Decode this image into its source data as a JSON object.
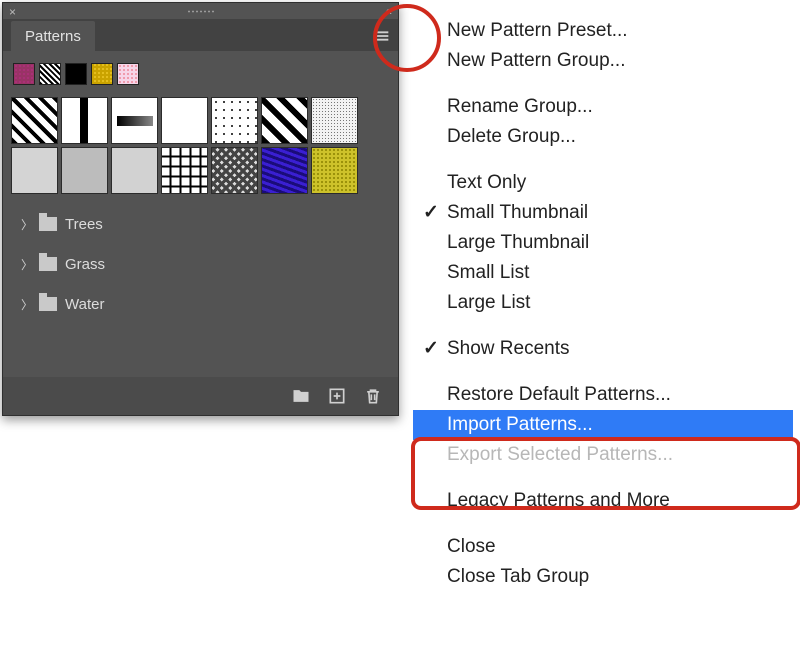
{
  "panel": {
    "title": "Patterns",
    "recents": [
      {
        "name": "pattern-noise-pink"
      },
      {
        "name": "pattern-stripe"
      },
      {
        "name": "pattern-black"
      },
      {
        "name": "pattern-yellow"
      },
      {
        "name": "pattern-pink-dots"
      }
    ],
    "grid": [
      "diagonal-stripes",
      "vertical-line",
      "horizontal-bar",
      "white",
      "dot-grid",
      "diagonal-thick",
      "fine-noise",
      "texture-1",
      "texture-2",
      "texture-3",
      "concentric-squares",
      "maze",
      "purple-wave",
      "gold-flecks"
    ],
    "folders": [
      {
        "label": "Trees"
      },
      {
        "label": "Grass"
      },
      {
        "label": "Water"
      }
    ],
    "footer": {
      "folder": "New group",
      "new": "Create new pattern",
      "trash": "Delete"
    }
  },
  "menu": {
    "items": [
      {
        "label": "New Pattern Preset...",
        "type": "item"
      },
      {
        "label": "New Pattern Group...",
        "type": "item"
      },
      {
        "type": "sep"
      },
      {
        "label": "Rename Group...",
        "type": "item"
      },
      {
        "label": "Delete Group...",
        "type": "item"
      },
      {
        "type": "sep"
      },
      {
        "label": "Text Only",
        "type": "item"
      },
      {
        "label": "Small Thumbnail",
        "type": "item",
        "checked": true
      },
      {
        "label": "Large Thumbnail",
        "type": "item"
      },
      {
        "label": "Small List",
        "type": "item"
      },
      {
        "label": "Large List",
        "type": "item"
      },
      {
        "type": "sep"
      },
      {
        "label": "Show Recents",
        "type": "item",
        "checked": true
      },
      {
        "type": "sep"
      },
      {
        "label": "Restore Default Patterns...",
        "type": "item"
      },
      {
        "label": "Import Patterns...",
        "type": "item",
        "selected": true
      },
      {
        "label": "Export Selected Patterns...",
        "type": "item",
        "disabled": true
      },
      {
        "type": "sep"
      },
      {
        "label": "Legacy Patterns and More",
        "type": "item"
      },
      {
        "type": "sep"
      },
      {
        "label": "Close",
        "type": "item"
      },
      {
        "label": "Close Tab Group",
        "type": "item"
      }
    ]
  }
}
